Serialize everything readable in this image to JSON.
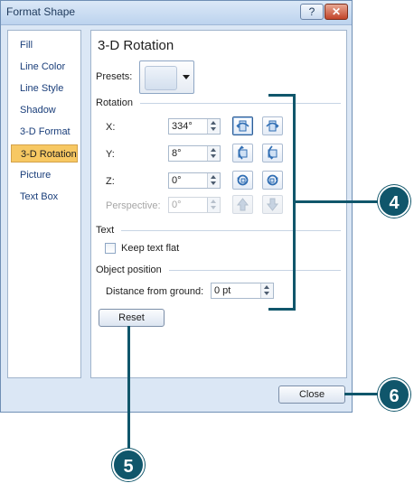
{
  "window": {
    "title": "Format Shape",
    "help_label": "?",
    "close_glyph": "✕"
  },
  "nav": {
    "items": [
      "Fill",
      "Line Color",
      "Line Style",
      "Shadow",
      "3-D Format",
      "3-D Rotation",
      "Picture",
      "Text Box"
    ],
    "selected": "3-D Rotation"
  },
  "panel": {
    "title": "3-D Rotation",
    "presets_label": "Presets:",
    "rotation_section": "Rotation",
    "x_label": "X:",
    "x_value": "334°",
    "y_label": "Y:",
    "y_value": "8°",
    "z_label": "Z:",
    "z_value": "0°",
    "perspective_label": "Perspective:",
    "perspective_value": "0°",
    "text_section": "Text",
    "keep_text_flat_label": "Keep text flat",
    "keep_text_flat_checked": false,
    "object_position_section": "Object position",
    "distance_label": "Distance from ground:",
    "distance_value": "0 pt",
    "reset_label": "Reset"
  },
  "footer": {
    "close_label": "Close"
  },
  "callouts": {
    "c4": "4",
    "c5": "5",
    "c6": "6"
  },
  "colors": {
    "callout": "#10566b",
    "selected_nav": "#f7c863",
    "nav_text": "#1a3e7a"
  }
}
